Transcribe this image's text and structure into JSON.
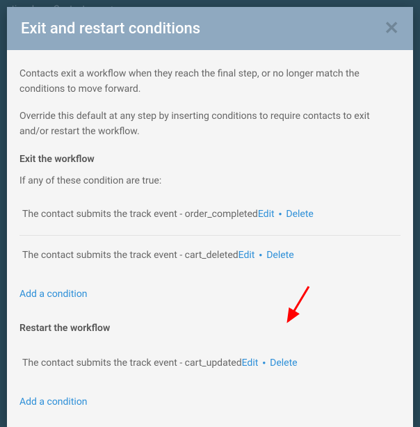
{
  "bg_nav": {
    "item1": "ctional",
    "item2": "Contacts",
    "item3": "+"
  },
  "modal": {
    "title": "Exit and restart conditions",
    "intro1": "Contacts exit a workflow when they reach the final step, or no longer match the conditions to move forward.",
    "intro2": "Override this default at any step by inserting conditions to require contacts to exit and/or restart the workflow.",
    "exit": {
      "title": "Exit the workflow",
      "subtitle": "If any of these condition are true:",
      "conditions": [
        {
          "text": "The contact submits the track event - order_completed",
          "edit": "Edit",
          "del": "Delete"
        },
        {
          "text": "The contact submits the track event - cart_deleted",
          "edit": "Edit",
          "del": "Delete"
        }
      ],
      "add": "Add a condition"
    },
    "restart": {
      "title": "Restart the workflow",
      "conditions": [
        {
          "text": "The contact submits the track event - cart_updated",
          "edit": "Edit",
          "del": "Delete"
        }
      ],
      "add": "Add a condition"
    }
  }
}
